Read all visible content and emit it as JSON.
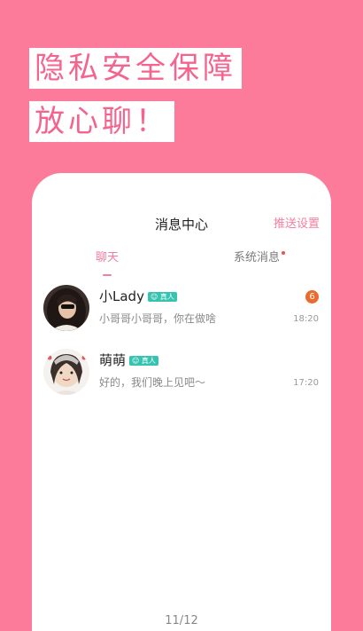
{
  "promo": {
    "line1": "隐私安全保障",
    "line2": "放心聊！"
  },
  "header": {
    "title": "消息中心",
    "push_settings": "推送设置"
  },
  "tabs": [
    {
      "label": "聊天",
      "active": true
    },
    {
      "label": "系统消息",
      "has_dot": true
    }
  ],
  "conversations": [
    {
      "name": "小Lady",
      "badge": "真人",
      "preview": "小哥哥小哥哥，你在做啥",
      "time": "18:20",
      "unread": "6"
    },
    {
      "name": "萌萌",
      "badge": "真人",
      "preview": "好的，我们晚上见吧～",
      "time": "17:20"
    }
  ],
  "pager": "11/12",
  "colors": {
    "background": "#fc7b9a",
    "accent": "#f27ea0",
    "badge": "#36c4b0",
    "unread": "#ed6a2e"
  }
}
